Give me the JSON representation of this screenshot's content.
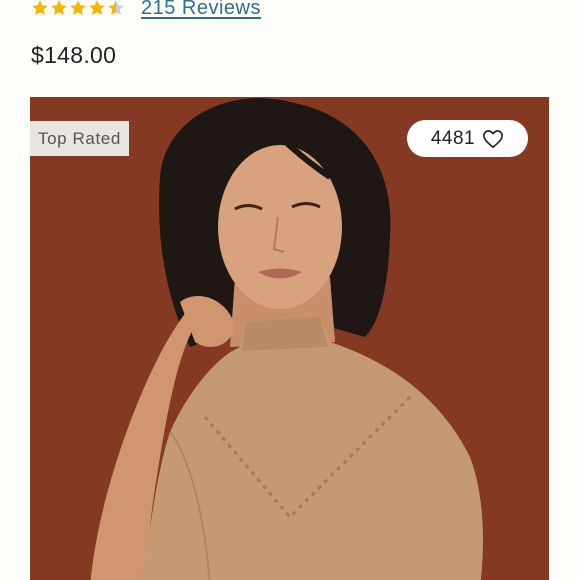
{
  "rating": {
    "value": 4.5,
    "max": 5,
    "star_color": "#f2b705",
    "empty_star_color": "#cfcfcf",
    "reviews_label": "215 Reviews"
  },
  "product": {
    "price": "$148.00",
    "badge": "Top Rated",
    "favorites_count": "4481",
    "image_background": "#8d3c25",
    "sweater_color": "#c59a72"
  },
  "icons": {
    "stars": "star-icon",
    "favorite": "heart-outline-icon"
  }
}
